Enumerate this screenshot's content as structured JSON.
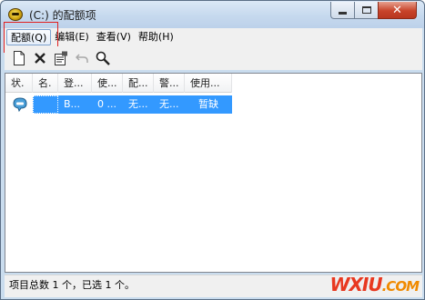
{
  "window": {
    "title": "(C:) 的配额项",
    "icon": "drive-quota-icon"
  },
  "menu": {
    "items": [
      {
        "label": "配额(Q)"
      },
      {
        "label": "编辑(E)"
      },
      {
        "label": "查看(V)"
      },
      {
        "label": "帮助(H)"
      }
    ]
  },
  "toolbar": {
    "buttons": [
      {
        "icon": "new-document-icon"
      },
      {
        "icon": "delete-icon"
      },
      {
        "icon": "properties-icon"
      },
      {
        "icon": "undo-icon"
      },
      {
        "icon": "find-icon"
      }
    ]
  },
  "list": {
    "columns": [
      "状.",
      "名.",
      "登...",
      "使...",
      "配...",
      "警...",
      "使用..."
    ],
    "rows": [
      {
        "status_icon": "quota-status-icon",
        "cells": [
          "",
          "B...",
          "0 ...",
          "无...",
          "无...",
          "暂缺"
        ]
      }
    ]
  },
  "status": {
    "text": "项目总数 1 个，已选 1 个。"
  },
  "watermark": {
    "main": "WXIU",
    "tld": ".COM"
  },
  "colors": {
    "selection": "#3399ff",
    "annotation_box": "#e02020"
  }
}
